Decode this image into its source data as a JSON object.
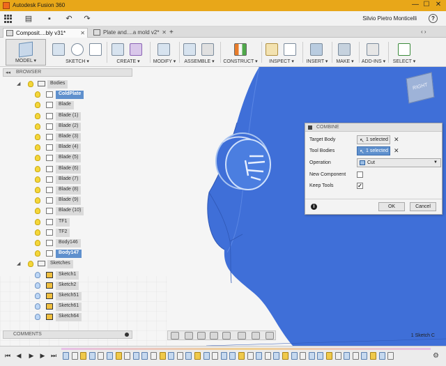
{
  "window": {
    "title": "Autodesk Fusion 360",
    "min_label": "—",
    "max_label": "☐",
    "close_label": "✕"
  },
  "qat": {
    "user_name": "Silvio Pietro Monticelli",
    "help_label": "?",
    "undo_label": "↶",
    "redo_label": "↷",
    "save_label": "▪"
  },
  "tabs": [
    {
      "label": "Composit....bly v31*"
    },
    {
      "label": "Plate and....a mold v2*"
    }
  ],
  "tabs_ctl": {
    "plus": "+",
    "nav": "‹ ›"
  },
  "toolbar": {
    "model_label": "MODEL ▾",
    "groups": [
      {
        "label": "SKETCH ▾"
      },
      {
        "label": "CREATE ▾"
      },
      {
        "label": "MODIFY ▾"
      },
      {
        "label": "ASSEMBLE ▾"
      },
      {
        "label": "CONSTRUCT ▾"
      },
      {
        "label": "INSPECT ▾"
      },
      {
        "label": "INSERT ▾"
      },
      {
        "label": "MAKE ▾"
      },
      {
        "label": "ADD-INS ▾"
      },
      {
        "label": "SELECT ▾"
      }
    ]
  },
  "browser": {
    "header": "BROWSER",
    "arrows": "◂◂",
    "bodies_label": "Bodies",
    "bodies": [
      {
        "label": "ColdPlate",
        "selected": true
      },
      {
        "label": "Blade",
        "selected": false
      },
      {
        "label": "Blade (1)",
        "selected": false
      },
      {
        "label": "Blade (2)",
        "selected": false
      },
      {
        "label": "Blade (3)",
        "selected": false
      },
      {
        "label": "Blade (4)",
        "selected": false
      },
      {
        "label": "Blade (5)",
        "selected": false
      },
      {
        "label": "Blade (6)",
        "selected": false
      },
      {
        "label": "Blade (7)",
        "selected": false
      },
      {
        "label": "Blade (8)",
        "selected": false
      },
      {
        "label": "Blade (9)",
        "selected": false
      },
      {
        "label": "Blade (10)",
        "selected": false
      },
      {
        "label": "TF1",
        "selected": false
      },
      {
        "label": "TF2",
        "selected": false
      },
      {
        "label": "Body146",
        "selected": false
      },
      {
        "label": "Body147",
        "selected": true
      }
    ],
    "sketches_label": "Sketches",
    "sketches": [
      {
        "label": "Sketch1"
      },
      {
        "label": "Sketch2"
      },
      {
        "label": "Sketch51"
      },
      {
        "label": "Sketch61"
      },
      {
        "label": "Sketch64"
      }
    ]
  },
  "comments": {
    "label": "COMMENTS"
  },
  "combine": {
    "title": "COMBINE",
    "target_body_label": "Target Body",
    "target_body_value": "1 selected",
    "tool_bodies_label": "Tool Bodies",
    "tool_bodies_value": "1 selected",
    "clear_label": "✕",
    "operation_label": "Operation",
    "operation_value": "Cut",
    "new_component_label": "New Component",
    "new_component_checked": "",
    "keep_tools_label": "Keep Tools",
    "keep_tools_checked": "✓",
    "ok_label": "OK",
    "cancel_label": "Cancel",
    "info_label": "i"
  },
  "viewcube": {
    "face_label": "RIGHT"
  },
  "status": {
    "selection_text": "1 Sketch C"
  },
  "colors": {
    "body_blue": "#3f6fd8",
    "selection_blue": "#5f90cd",
    "title_orange": "#e8a719"
  }
}
